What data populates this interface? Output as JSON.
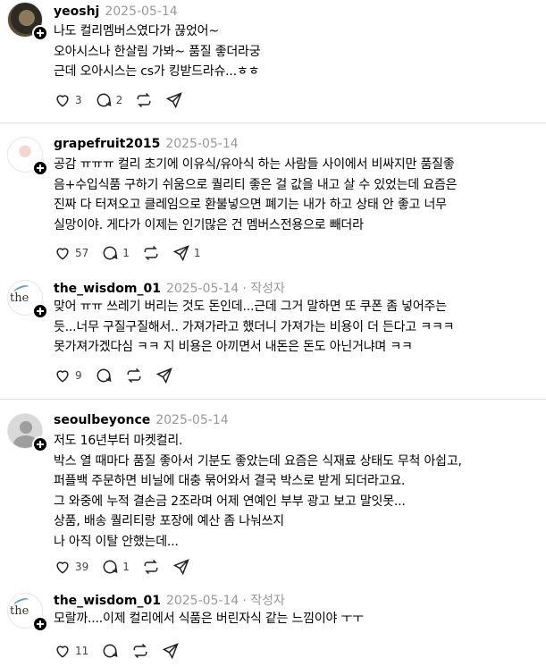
{
  "colors": {
    "text": "#000000",
    "meta": "#999999",
    "divider": "#e3e3e3",
    "badge": "#000000"
  },
  "posts": [
    {
      "username": "yeoshj",
      "date": "2025-05-14",
      "author_badge": "",
      "lines": [
        "나도 컬리멤버스였다가 끊었어~",
        "오아시스나 한살림 가봐~ 품질 좋더라궁",
        "근데 오아시스는 cs가 킹받드라슈...ㅎㅎ"
      ],
      "likes": "3",
      "replies": "2",
      "reposts": ""
    },
    {
      "username": "grapefruit2015",
      "date": "2025-05-14",
      "author_badge": "",
      "lines": [
        "공감 ㅠㅠㅠ 컬리 초기에 이유식/유아식 하는 사람들 사이에서 비싸지만 품질좋",
        "음+수입식품 구하기 쉬움으로 퀄리티 좋은 걸 값을 내고 살 수 있었는데 요즘은",
        "진짜 다 터져오고 클레임으로 환불넣으면 폐기는 내가 하고 상태 안 좋고 너무",
        "실망이야. 게다가 이제는 인기많은 건 멤버스전용으로 빼더라"
      ],
      "likes": "57",
      "replies": "1",
      "reposts": "",
      "shares": "1"
    },
    {
      "username": "the_wisdom_01",
      "date": "2025-05-14",
      "author_badge": "· 작성자",
      "lines": [
        "맞어 ㅠㅠ 쓰레기 버리는 것도 돈인데...근데 그거 말하면 또 쿠폰 좀 넣어주는",
        "듯...너무 구질구질해서.. 가져가라고 했더니 가져가는 비용이 더 든다고 ㅋㅋㅋ",
        "못가져가겠다심 ㅋㅋ 지 비용은 아끼면서 내돈은 돈도 아닌거냐며 ㅋㅋ"
      ],
      "likes": "9",
      "replies": "",
      "reposts": ""
    },
    {
      "username": "seoulbeyonce",
      "date": "2025-05-14",
      "author_badge": "",
      "lines": [
        "저도 16년부터 마켓컬리.",
        "박스 열 때마다 품질 좋아서 기분도 좋았는데 요즘은 식재료 상태도 무척 아쉽고,",
        "퍼플백 주문하면 비닐에 대충 묶어와서 결국 박스로 받게 되더라고요.",
        "그 와중에 누적 결손금 2조라며 어제 연예인 부부 광고 보고 말잇못...",
        "상품, 배송 퀄리티랑 포장에 예산 좀 나눠쓰지",
        "나 아직 이탈 안했는데..."
      ],
      "likes": "39",
      "replies": "1",
      "reposts": ""
    },
    {
      "username": "the_wisdom_01",
      "date": "2025-05-14",
      "author_badge": "· 작성자",
      "lines": [
        "모랄까....이제 컬리에서 식품은 버린자식 같는 느낌이야 ㅜㅜ"
      ],
      "likes": "11",
      "replies": "",
      "reposts": ""
    }
  ]
}
